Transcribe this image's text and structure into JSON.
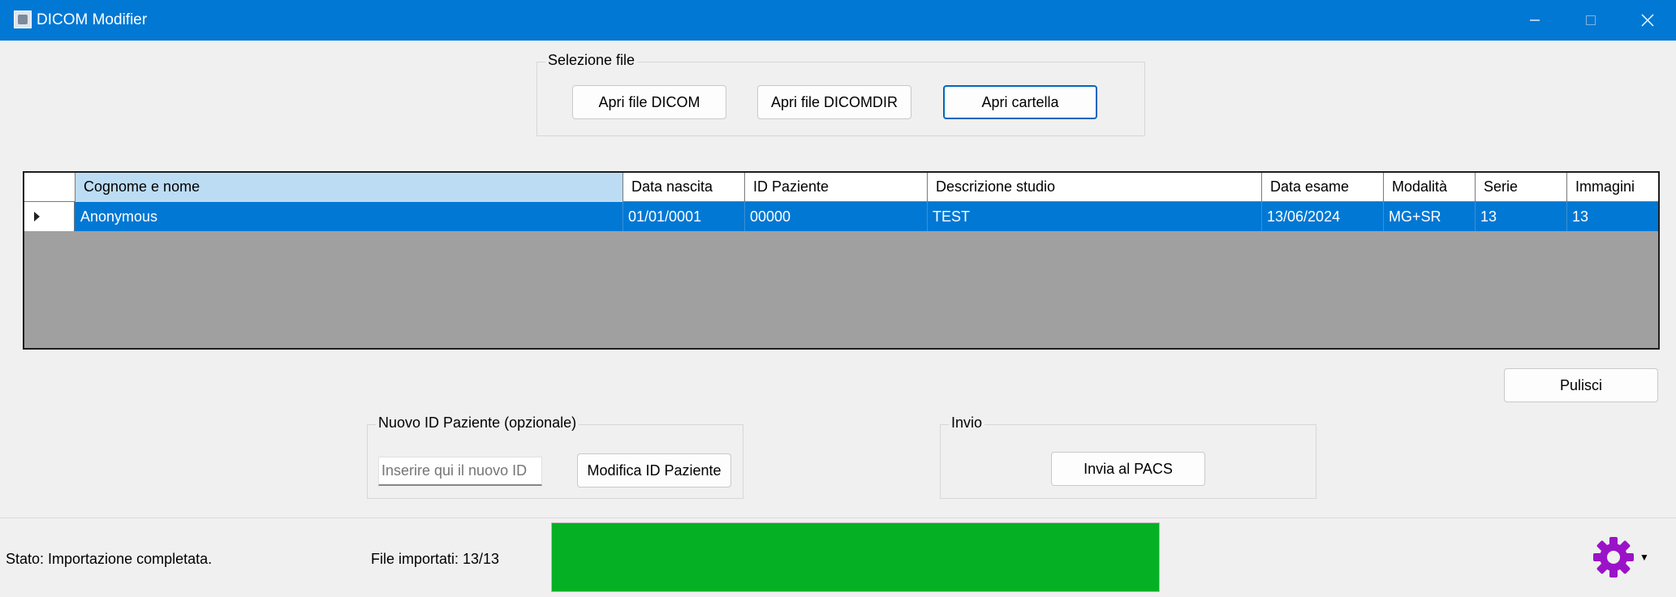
{
  "window": {
    "title": "DICOM Modifier"
  },
  "file_selection": {
    "legend": "Selezione file",
    "open_dicom": "Apri file DICOM",
    "open_dicomdir": "Apri file DICOMDIR",
    "open_folder": "Apri cartella"
  },
  "grid": {
    "columns": [
      "Cognome e nome",
      "Data nascita",
      "ID Paziente",
      "Descrizione studio",
      "Data esame",
      "Modalità",
      "Serie",
      "Immagini"
    ],
    "rows": [
      [
        "Anonymous",
        "01/01/0001",
        "00000",
        "TEST",
        "13/06/2024",
        "MG+SR",
        "13",
        "13"
      ]
    ]
  },
  "clear_button": "Pulisci",
  "new_id": {
    "legend": "Nuovo ID Paziente (opzionale)",
    "placeholder": "Inserire qui il nuovo ID",
    "value": "",
    "modify_button": "Modifica ID Paziente"
  },
  "send": {
    "legend": "Invio",
    "send_button": "Invia al PACS"
  },
  "status": {
    "state_text": "Stato: Importazione completata.",
    "files_imported": "File importati: 13/13",
    "progress_fraction": 1.0,
    "progress_color": "#06b025"
  },
  "colors": {
    "titlebar": "#0078d4",
    "selection": "#0078d4",
    "gear": "#9b13c8"
  },
  "icons": {
    "settings": "gear-icon"
  }
}
